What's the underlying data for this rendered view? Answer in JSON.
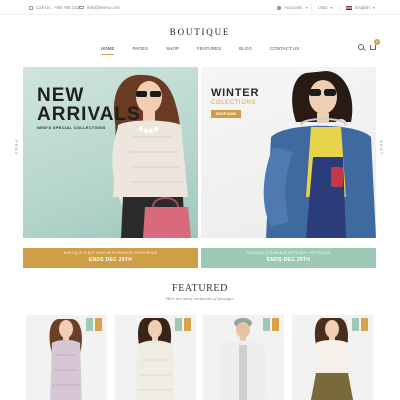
{
  "topbar": {
    "phone": "Call Us : +88 765 432",
    "email": "info@demo.com",
    "account": "Accounts",
    "currency": "USD",
    "language": "English"
  },
  "logo": "BOUTIQUE",
  "nav": {
    "items": [
      "HOME",
      "PAGES",
      "SHOP",
      "FEATURES",
      "BLOG",
      "CONTACT US"
    ],
    "active": "HOME",
    "cart_count": "0"
  },
  "hero": {
    "left": {
      "title_line1": "NEW",
      "title_line2": "ARRIVALS",
      "subtitle": "NEW'S SPECIAL COLLECTIONS"
    },
    "right": {
      "title_line1": "WINTER",
      "title_line2": "COLECTIONS",
      "button": "SHOP NOW"
    },
    "prev": "PREV",
    "next": "NEXT"
  },
  "promos": [
    {
      "line1": "BOUTIQUE IS NOT OVER WITH FASHION FEVER BEGIN",
      "line2": "ENDS DEC 29TH",
      "color": "#cf9f47"
    },
    {
      "line1": "BOUTIQUE CLEARANCE UP TO 50% + EXTRA 10%",
      "line2": "ENDS DEC 29TH",
      "color": "#9ecab5"
    }
  ],
  "featured": {
    "title": "FEATURED",
    "subtitle": "Here are many variations of passages"
  },
  "colors": {
    "accent_gold": "#c9a24a",
    "mint": "#9ecab5",
    "gold": "#cf9f47"
  }
}
